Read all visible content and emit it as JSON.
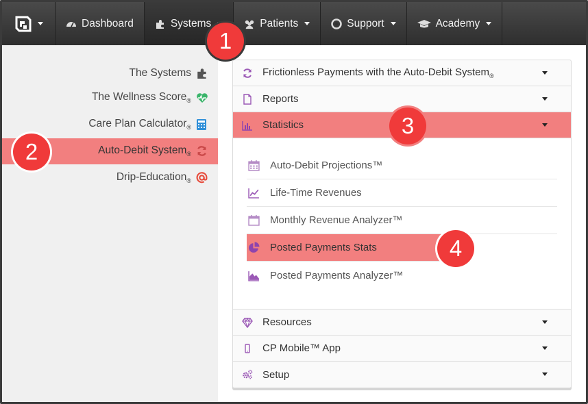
{
  "colors": {
    "nav_bg": "#333333",
    "highlight": "#f27f7f",
    "badge": "#f03a3a",
    "icon_purple": "#9b59b6"
  },
  "nav": {
    "logo_icon": "brand-logo-icon",
    "items": [
      {
        "label": "Dashboard",
        "icon": "dashboard-icon"
      },
      {
        "label": "Systems",
        "icon": "puzzle-icon"
      },
      {
        "label": "Patients",
        "icon": "users-icon"
      },
      {
        "label": "Support",
        "icon": "life-ring-icon"
      },
      {
        "label": "Academy",
        "icon": "graduation-cap-icon"
      }
    ]
  },
  "sidebar": {
    "items": [
      {
        "label": "The Systems",
        "reg": "",
        "icon": "puzzle-icon"
      },
      {
        "label": "The Wellness Score",
        "reg": "®",
        "icon": "heartbeat-icon"
      },
      {
        "label": "Care Plan Calculator",
        "reg": "®",
        "icon": "calculator-icon"
      },
      {
        "label": "Auto-Debit System",
        "reg": "®",
        "icon": "refresh-icon"
      },
      {
        "label": "Drip-Education",
        "reg": "®",
        "icon": "at-icon"
      }
    ]
  },
  "panel": {
    "sections": [
      {
        "label": "Frictionless Payments with the Auto-Debit System",
        "reg": "®",
        "icon": "refresh-icon"
      },
      {
        "label": "Reports",
        "reg": "",
        "icon": "file-icon"
      },
      {
        "label": "Statistics",
        "reg": "",
        "icon": "bar-chart-icon"
      },
      {
        "label": "Resources",
        "reg": "",
        "icon": "diamond-icon"
      },
      {
        "label": "CP Mobile™ App",
        "reg": "",
        "icon": "mobile-icon"
      },
      {
        "label": "Setup",
        "reg": "",
        "icon": "cogs-icon"
      }
    ],
    "statistics_items": [
      {
        "label": "Auto-Debit Projections™",
        "icon": "calendar-icon"
      },
      {
        "label": "Life-Time Revenues",
        "icon": "line-chart-icon"
      },
      {
        "label": "Monthly Revenue Analyzer™",
        "icon": "calendar-blank-icon"
      },
      {
        "label": "Posted Payments Stats",
        "icon": "pie-chart-icon"
      },
      {
        "label": "Posted Payments Analyzer™",
        "icon": "area-chart-icon"
      }
    ]
  },
  "badges": [
    "1",
    "2",
    "3",
    "4"
  ]
}
